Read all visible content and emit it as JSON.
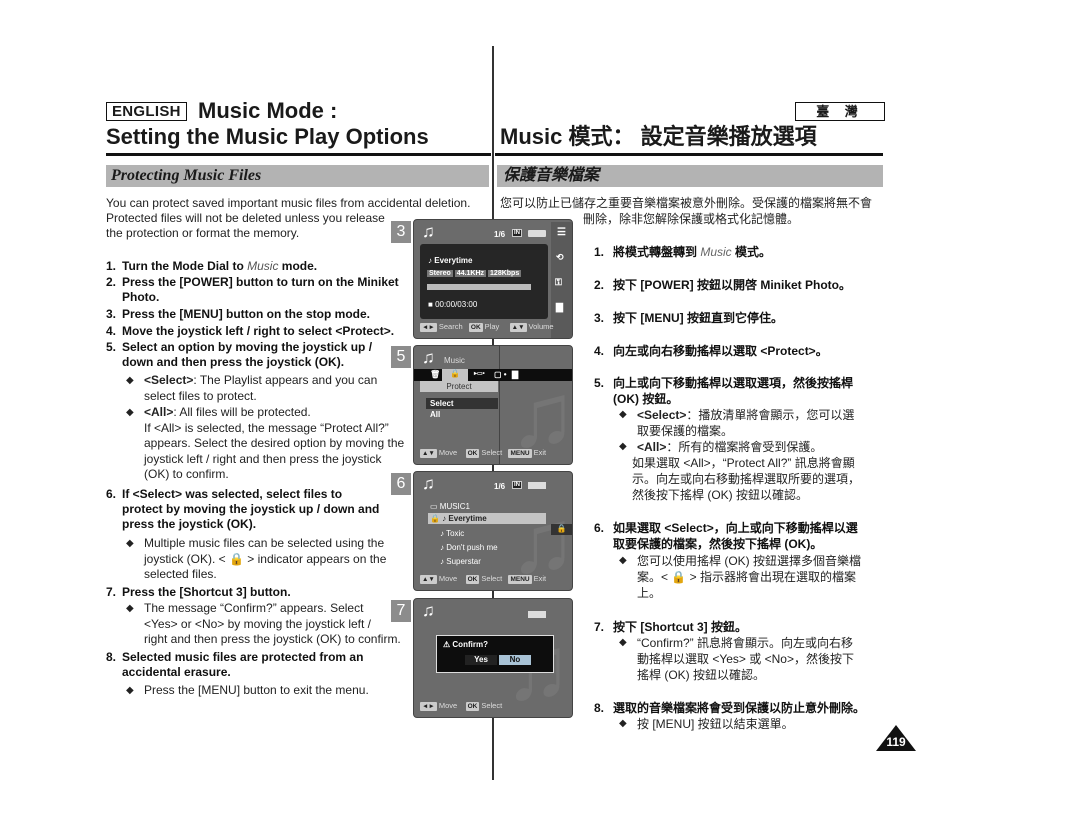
{
  "header": {
    "language_badge": "ENGLISH",
    "title_en_line1": "Music Mode :",
    "title_en_line2": "Setting the Music Play Options",
    "region_badge": "臺 灣",
    "title_zh": "Music 模式： 設定音樂播放選項"
  },
  "section": {
    "title_en": "Protecting Music Files",
    "title_zh": "保護音樂檔案"
  },
  "intro_en": [
    "You can protect saved important music files from accidental deletion.",
    "Protected files will not be deleted unless you release",
    "the protection or format the memory."
  ],
  "intro_zh": [
    "您可以防止已儲存之重要音樂檔案被意外刪除。受保護的檔案將無不會",
    "刪除，除非您解除保護或格式化記憶體。"
  ],
  "steps_en": [
    {
      "num": "1.",
      "lines": [
        "Turn the Mode Dial to ",
        "Music",
        " mode."
      ]
    },
    {
      "num": "2.",
      "lines": [
        "Press the [POWER] button to turn on the Miniket",
        "Photo."
      ]
    },
    {
      "num": "3.",
      "lines": [
        "Press the [MENU] button on the stop mode."
      ]
    },
    {
      "num": "4.",
      "lines": [
        "Move the joystick left / right to select <Protect>."
      ]
    },
    {
      "num": "5.",
      "lines": [
        "Select an option by moving the joystick up /",
        "down and then press the joystick (OK)."
      ]
    },
    {
      "num": "6.",
      "lines": [
        "If <Select> was selected, select files to",
        "protect by moving the joystick up / down and",
        "press the joystick (OK)."
      ]
    },
    {
      "num": "7.",
      "lines": [
        "Press the [Shortcut 3] button."
      ]
    },
    {
      "num": "8.",
      "lines": [
        "Selected music files are protected from an",
        "accidental erasure."
      ]
    }
  ],
  "bullets_en": {
    "step5_select": {
      "term": "<Select>",
      "lines": [
        ": The Playlist appears and you can",
        "select files to protect."
      ]
    },
    "step5_all": {
      "term": "<All>",
      "lines": [
        ": All files will be protected.",
        "If <All> is selected, the message “Protect All?”",
        "appears. Select the desired option by moving the",
        "joystick left / right and then press the joystick",
        "(OK) to confirm."
      ]
    },
    "step6": {
      "lines": [
        "Multiple music files can be selected using the",
        "joystick (OK). < 🔒 > indicator appears on the",
        "selected files."
      ]
    },
    "step7": {
      "lines": [
        "The message “Confirm?” appears. Select",
        "<Yes> or <No> by moving the joystick left /",
        "right and then press the joystick (OK) to confirm."
      ]
    },
    "step8": {
      "lines": [
        "Press the [MENU] button to exit the menu."
      ]
    }
  },
  "steps_zh": [
    {
      "num": "1.",
      "a": "將模式轉盤轉到 ",
      "b": "Music",
      "c": " 模式。"
    },
    {
      "num": "2.",
      "a": "按下 [POWER] 按鈕以開啓 Miniket Photo。"
    },
    {
      "num": "3.",
      "a": "按下 [MENU] 按鈕直到它停住。"
    },
    {
      "num": "4.",
      "a": "向左或向右移動搖桿以選取 <Protect>。"
    },
    {
      "num": "5.",
      "a": "向上或向下移動搖桿以選取選項，然後按搖桿",
      "a2": "(OK) 按鈕。"
    },
    {
      "num": "6.",
      "a": "如果選取 <Select>，向上或向下移動搖桿以選",
      "a2": "取要保護的檔案，然後按下搖桿 (OK)。"
    },
    {
      "num": "7.",
      "a": "按下 [Shortcut 3] 按鈕。"
    },
    {
      "num": "8.",
      "a": "選取的音樂檔案將會受到保護以防止意外刪除。"
    }
  ],
  "bullets_zh": {
    "step5_select": {
      "term": "<Select>",
      "l1": "：播放清單將會顯示，您可以選",
      "l2": "取要保護的檔案。"
    },
    "step5_all": {
      "term": "<All>",
      "l1": "：所有的檔案將會受到保護。",
      "l2": "如果選取 <All>，“Protect All?” 訊息將會顯",
      "l3": "示。向左或向右移動搖桿選取所要的選項，",
      "l4": "然後按下搖桿 (OK) 按鈕以確認。"
    },
    "step6": {
      "l1": "您可以使用搖桿 (OK) 按鈕選擇多個音樂檔",
      "l2": "案。< 🔒 > 指示器將會出現在選取的檔案",
      "l3": "上。"
    },
    "step7": {
      "l1": "“Confirm?” 訊息將會顯示。向左或向右移",
      "l2": "動搖桿以選取 <Yes> 或 <No>，然後按下",
      "l3": "搖桿 (OK) 按鈕以確認。"
    },
    "step8": {
      "l1": "按 [MENU] 按鈕以結束選單。"
    }
  },
  "screens": {
    "s3": {
      "tab": "3",
      "counter": "1/6",
      "memory": "IN",
      "track": "Everytime",
      "info": [
        "Stereo",
        "44.1KHz",
        "128Kbps"
      ],
      "time": "00:00/03:00",
      "footer": [
        {
          "key": "◄►",
          "label": "Search"
        },
        {
          "key": "OK",
          "label": "Play"
        },
        {
          "key": "▲▼",
          "label": "Volume"
        }
      ],
      "side_icons": [
        "playlist-icon",
        "repeat-icon",
        "protect-icon",
        "equalizer-icon"
      ]
    },
    "s5": {
      "tab": "5",
      "mode": "Music",
      "menu_label": "Protect",
      "options": [
        "Select",
        "All"
      ],
      "selected": "Select",
      "footer": [
        {
          "key": "▲▼",
          "label": "Move"
        },
        {
          "key": "OK",
          "label": "Select"
        },
        {
          "key": "MENU",
          "label": "Exit"
        }
      ]
    },
    "s6": {
      "tab": "6",
      "counter": "1/6",
      "memory": "IN",
      "folder": "MUSIC1",
      "tracks": [
        "Everytime",
        "Toxic",
        "Don't push me",
        "Superstar"
      ],
      "selected_track": "Everytime",
      "footer": [
        {
          "key": "▲▼",
          "label": "Move"
        },
        {
          "key": "OK",
          "label": "Select"
        },
        {
          "key": "MENU",
          "label": "Exit"
        }
      ]
    },
    "s7": {
      "tab": "7",
      "dialog_title": "Confirm?",
      "yes": "Yes",
      "no": "No",
      "selected": "No",
      "footer": [
        {
          "key": "◄►",
          "label": "Move"
        },
        {
          "key": "OK",
          "label": "Select"
        }
      ]
    }
  },
  "page_number": "119"
}
